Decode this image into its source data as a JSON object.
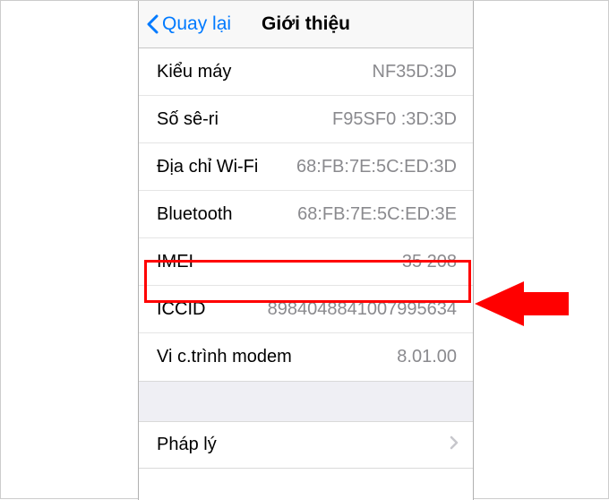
{
  "header": {
    "back_label": "Quay lại",
    "title": "Giới thiệu"
  },
  "rows": [
    {
      "label": "Kiểu máy",
      "value": "NF35D:3D"
    },
    {
      "label": "Số sê-ri",
      "value": "F95SF0 :3D:3D"
    },
    {
      "label": "Địa chỉ Wi-Fi",
      "value": "68:FB:7E:5C:ED:3D"
    },
    {
      "label": "Bluetooth",
      "value": "68:FB:7E:5C:ED:3E"
    },
    {
      "label": "IMEI",
      "value": "35 208"
    },
    {
      "label": "ICCID",
      "value": "8984048841007995634"
    },
    {
      "label": "Vi c.trình modem",
      "value": "8.01.00"
    }
  ],
  "legal": {
    "label": "Pháp lý"
  },
  "highlight": {
    "row_index": 4
  },
  "colors": {
    "accent": "#007aff",
    "highlight": "#ff0000"
  }
}
